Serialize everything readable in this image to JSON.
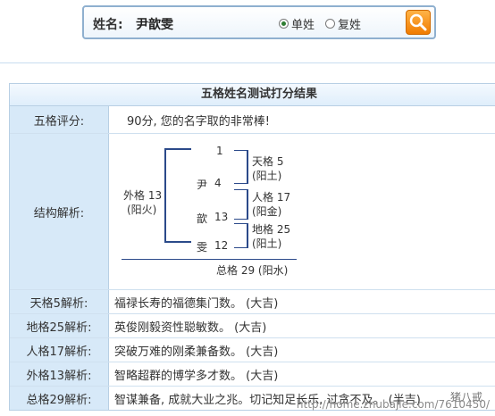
{
  "search": {
    "name_label": "姓名:",
    "name_value": "尹歆雯",
    "options": [
      {
        "label": "单姓",
        "selected": true
      },
      {
        "label": "复姓",
        "selected": false
      }
    ],
    "button_icon": "search-icon"
  },
  "result": {
    "title": "五格姓名测试打分结果",
    "score_label": "五格评分:",
    "score_text": "90分, 您的名字取的非常棒!",
    "structure_label": "结构解析:",
    "structure": {
      "outer": "外格 13",
      "outer_element": "(阳火)",
      "chars": [
        {
          "char": "",
          "num": "1"
        },
        {
          "char": "尹",
          "num": "4"
        },
        {
          "char": "歆",
          "num": "13"
        },
        {
          "char": "雯",
          "num": "12"
        }
      ],
      "tian": "天格 5",
      "tian_element": "(阳土)",
      "ren": "人格 17",
      "ren_element": "(阳金)",
      "di": "地格 25",
      "di_element": "(阳土)",
      "total": "总格 29 (阳水)"
    },
    "analysis": [
      {
        "label": "天格5解析:",
        "text": "福禄长寿的福德集门数。    (大吉)"
      },
      {
        "label": "地格25解析:",
        "text": "英俊刚毅资性聪敏数。    (大吉)"
      },
      {
        "label": "人格17解析:",
        "text": "突破万难的刚柔兼备数。    (大吉)"
      },
      {
        "label": "外格13解析:",
        "text": "智略超群的博学多才数。    (大吉)"
      },
      {
        "label": "总格29解析:",
        "text": "智谋兼备, 成就大业之兆。切记知足长乐, 过贪不及。 (半吉)"
      }
    ]
  },
  "watermark": {
    "site": "http://home.zhubajie.com/7610450/",
    "brand": "猪八戒"
  },
  "colors": {
    "accent": "#f07c00",
    "label_bg": "#d7e9f8",
    "score": "#cc0000",
    "border": "#b8cfe4"
  }
}
